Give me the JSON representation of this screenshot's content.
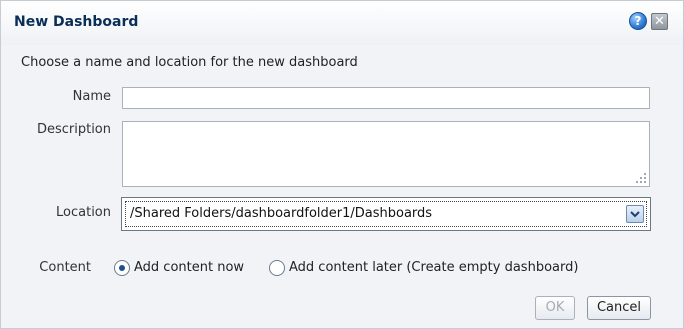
{
  "dialog": {
    "title": "New Dashboard",
    "help_icon_glyph": "?",
    "close_icon_glyph": "✕",
    "intro": "Choose a name and location for the new dashboard"
  },
  "form": {
    "name_label": "Name",
    "name_value": "",
    "description_label": "Description",
    "description_value": "",
    "location_label": "Location",
    "location_value": "/Shared Folders/dashboardfolder1/Dashboards",
    "content_label": "Content",
    "content_options": [
      {
        "label": "Add content now",
        "selected": true
      },
      {
        "label": "Add content later (Create empty dashboard)",
        "selected": false
      }
    ]
  },
  "buttons": {
    "ok_label": "OK",
    "cancel_label": "Cancel"
  },
  "colors": {
    "title": "#0b2e59",
    "radio_selected": "#1e4f8f",
    "disabled_text": "#a6acb3"
  },
  "icons": {
    "help": "help-icon",
    "close": "close-icon",
    "dropdown": "chevron-down-icon",
    "resize": "resize-grip-icon"
  }
}
